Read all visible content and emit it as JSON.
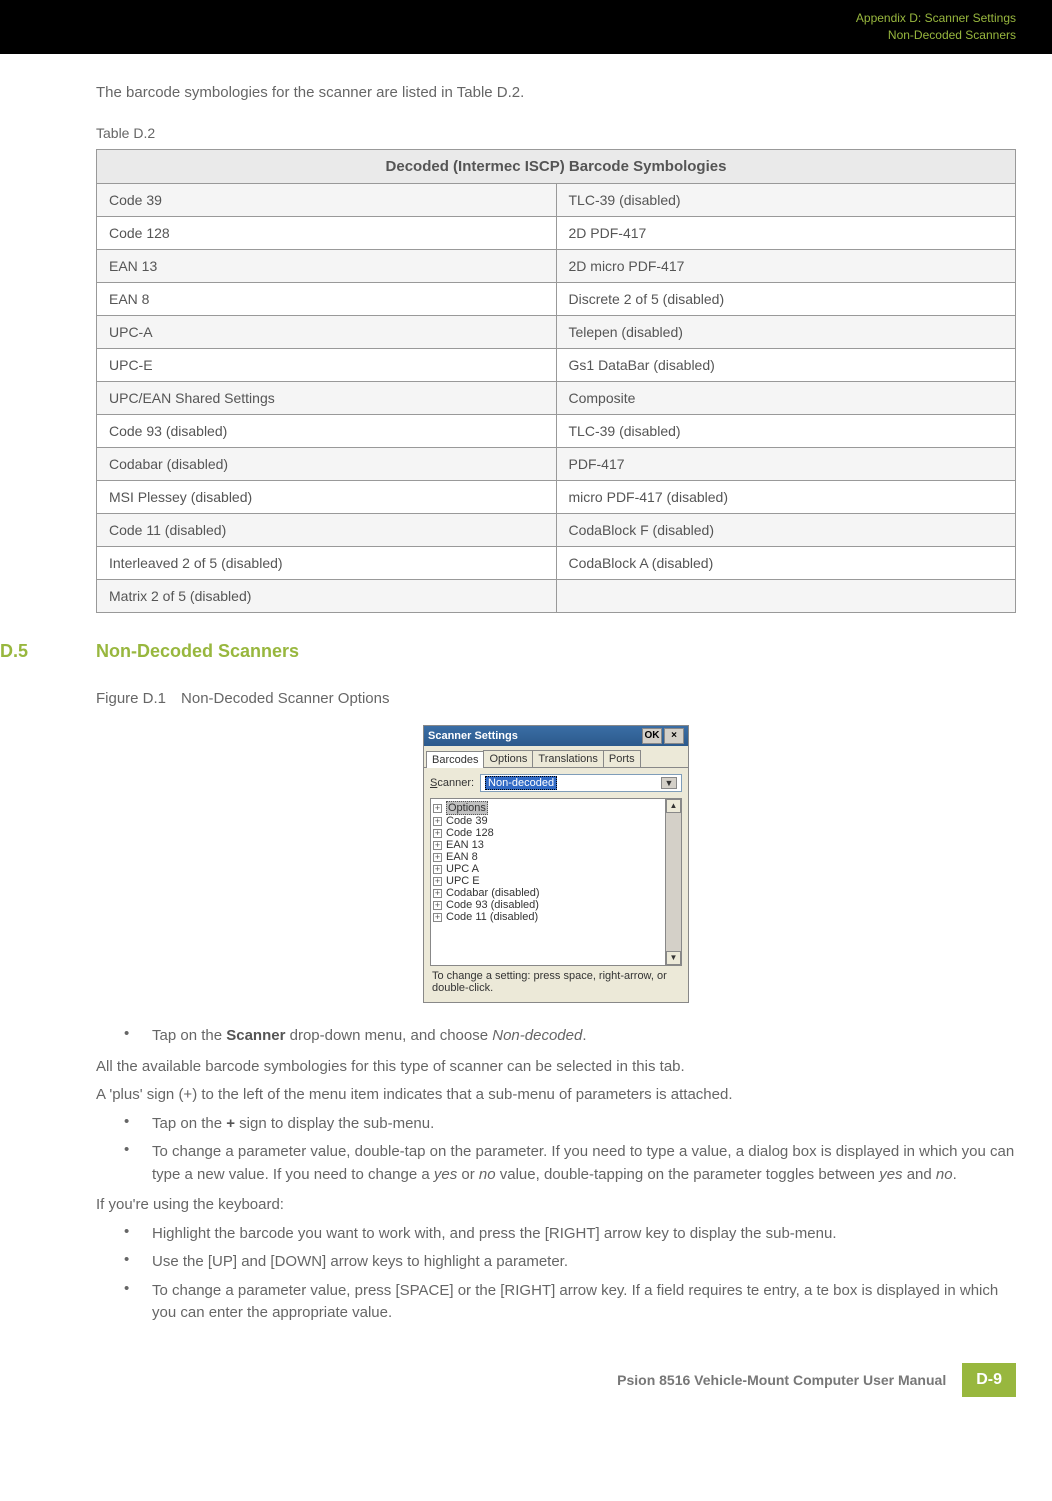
{
  "header": {
    "line1": "Appendix D: Scanner Settings",
    "line2": "Non-Decoded Scanners"
  },
  "intro": "The barcode symbologies for the scanner are listed in Table D.2.",
  "table_label": "Table D.2",
  "table_header": "Decoded (Intermec ISCP) Barcode Symbologies",
  "table_rows": [
    {
      "l": "Code 39",
      "r": "TLC-39 (disabled)"
    },
    {
      "l": "Code 128",
      "r": "2D PDF-417"
    },
    {
      "l": "EAN 13",
      "r": "2D micro PDF-417"
    },
    {
      "l": "EAN 8",
      "r": "Discrete 2 of 5 (disabled)"
    },
    {
      "l": "UPC-A",
      "r": "Telepen (disabled)"
    },
    {
      "l": "UPC-E",
      "r": "Gs1 DataBar (disabled)"
    },
    {
      "l": "UPC/EAN Shared Settings",
      "r": "Composite"
    },
    {
      "l": "Code 93 (disabled)",
      "r": "TLC-39 (disabled)"
    },
    {
      "l": "Codabar (disabled)",
      "r": "PDF-417"
    },
    {
      "l": "MSI Plessey (disabled)",
      "r": "micro PDF-417 (disabled)"
    },
    {
      "l": "Code 11 (disabled)",
      "r": "CodaBlock F (disabled)"
    },
    {
      "l": "Interleaved 2 of 5 (disabled)",
      "r": "CodaBlock A (disabled)"
    },
    {
      "l": "Matrix 2 of 5 (disabled)",
      "r": ""
    }
  ],
  "section": {
    "num": "D.5",
    "title": "Non-Decoded Scanners"
  },
  "figure_label": "Figure D.1 Non-Decoded Scanner Options",
  "screenshot": {
    "title": "Scanner Settings",
    "ok": "OK",
    "close": "×",
    "tabs": [
      "Barcodes",
      "Options",
      "Translations",
      "Ports"
    ],
    "scanner_label": "Scanner:",
    "scanner_value": "Non-decoded",
    "tree": [
      "Options",
      "Code 39",
      "Code 128",
      "EAN 13",
      "EAN 8",
      "UPC A",
      "UPC E",
      "Codabar (disabled)",
      "Code 93 (disabled)",
      "Code 11 (disabled)"
    ],
    "hint": "To change a setting: press space, right-arrow, or double-click."
  },
  "instr1_pre": "Tap on the ",
  "instr1_bold": "Scanner",
  "instr1_post": " drop-down menu, and choose ",
  "instr1_italic": "Non-decoded",
  "instr1_end": ".",
  "para1": "All the available barcode symbologies for this type of scanner can be selected in this tab.",
  "para2": "A 'plus' sign (+) to the left of the menu item indicates that a sub-menu of parameters is attached.",
  "instr2_pre": "Tap on the ",
  "instr2_bold": "+",
  "instr2_post": " sign to display the sub-menu.",
  "instr3_a": "To change a parameter value, double-tap on the parameter. If you need to type a value, a dialog box is displayed in which you can type a new value. If you need to change a ",
  "instr3_yes": "yes",
  "instr3_or": " or ",
  "instr3_no": "no",
  "instr3_b": " value, double-tapping on the parameter toggles between ",
  "instr3_and": " and ",
  "instr3_end": ".",
  "para3": "If you're using the keyboard:",
  "kbd1": "Highlight the barcode you want to work with, and press the [RIGHT] arrow key to display the sub-menu.",
  "kbd2": "Use the [UP] and [DOWN] arrow keys to highlight a parameter.",
  "kbd3": "To change a parameter value, press [SPACE] or the [RIGHT] arrow key. If a field requires te entry, a te box is displayed in which you can enter the appropriate value.",
  "footer": {
    "title": "Psion 8516 Vehicle-Mount Computer User Manual",
    "page": "D-9"
  }
}
